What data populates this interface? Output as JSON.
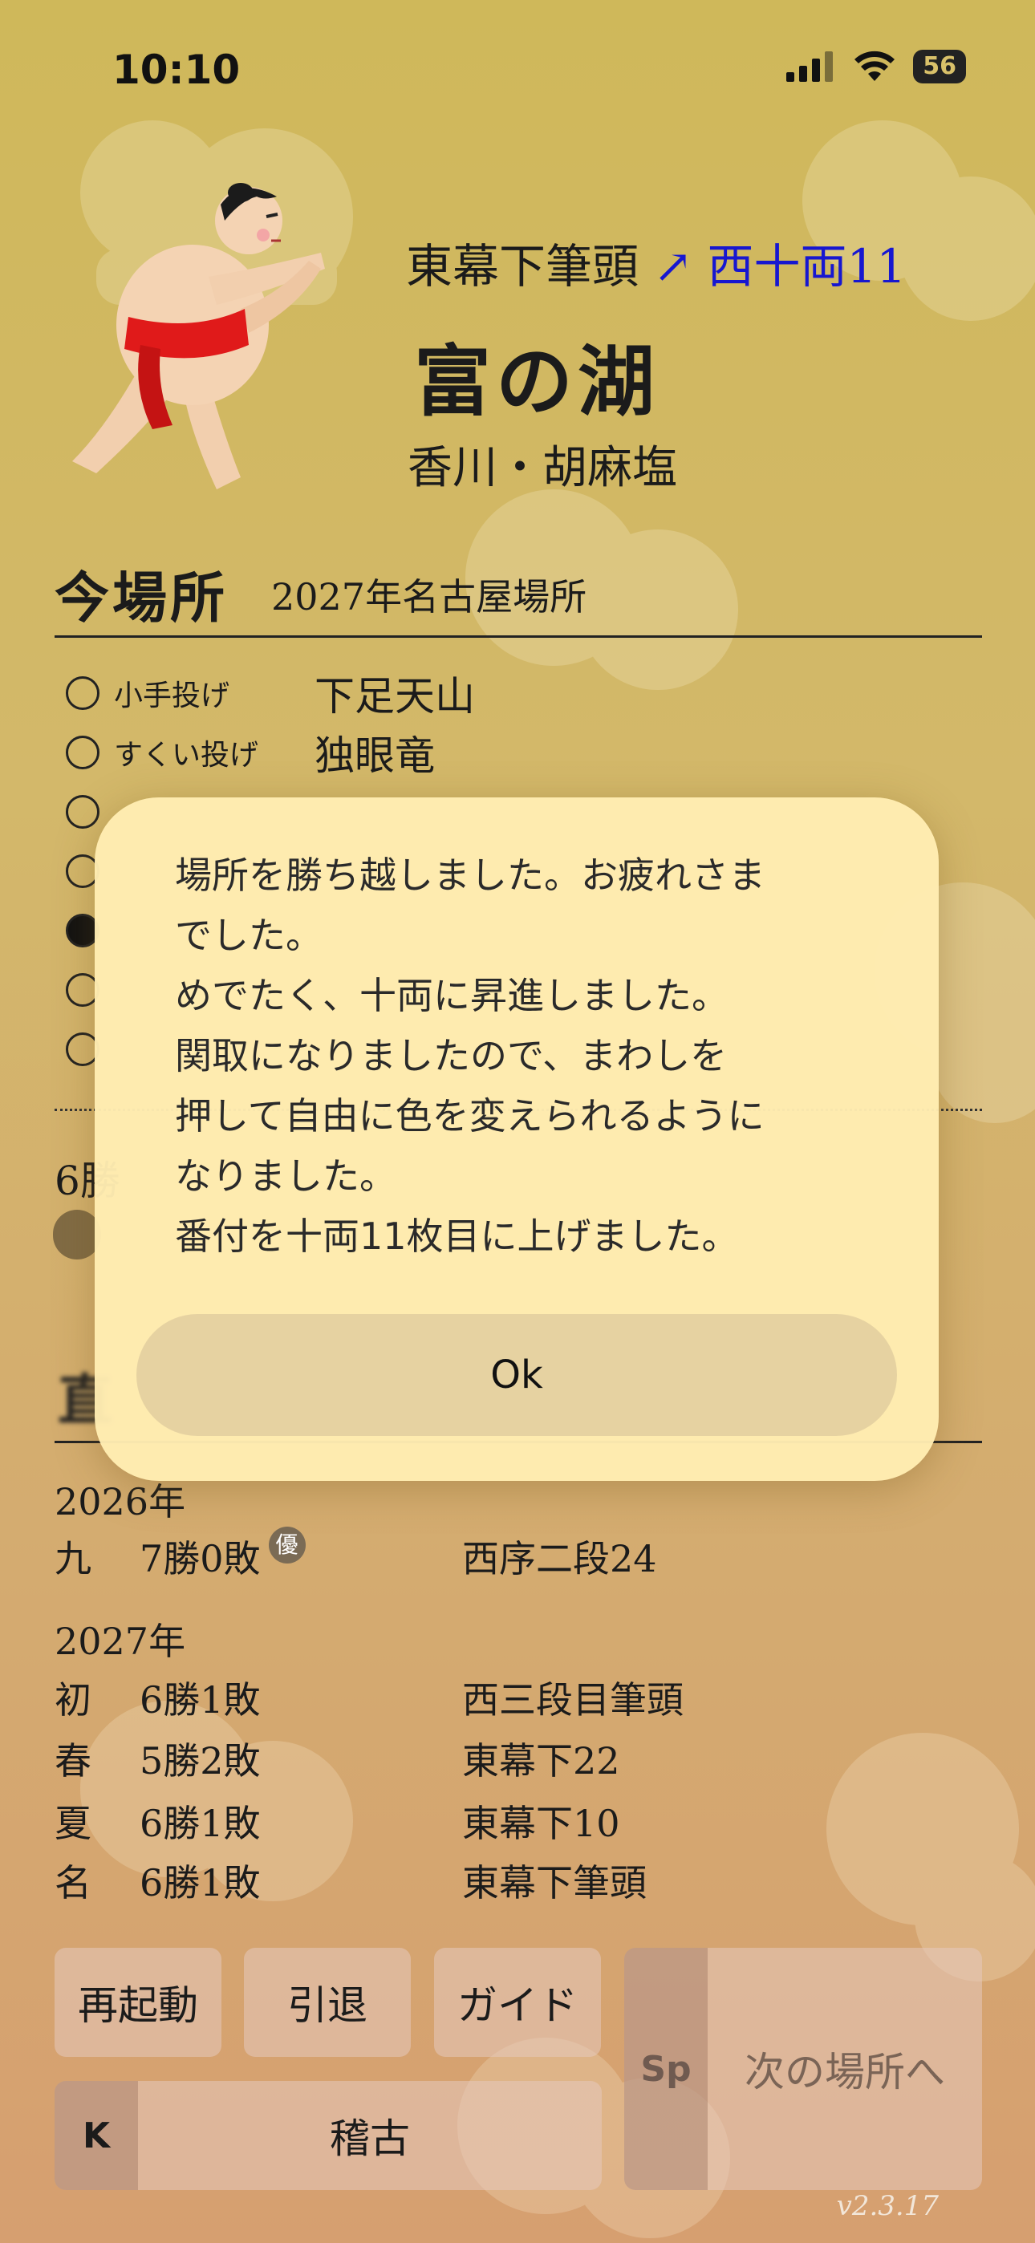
{
  "status_bar": {
    "time": "10:10",
    "battery": "56"
  },
  "wrestler": {
    "current_rank": "東幕下筆頭",
    "arrow": "↗",
    "new_rank": "西十両11",
    "shikona": "富の湖",
    "origin": "香川・胡麻塩"
  },
  "current_basho": {
    "title": "今場所",
    "name": "2027年名古屋場所",
    "bouts": [
      {
        "technique": "小手投げ",
        "opponent": "下足天山",
        "selected": false
      },
      {
        "technique": "すくい投げ",
        "opponent": "独眼竜",
        "selected": false
      },
      {
        "technique": "",
        "opponent": "",
        "selected": false
      },
      {
        "technique": "",
        "opponent": "",
        "selected": false
      },
      {
        "technique": "",
        "opponent": "",
        "selected": true
      },
      {
        "technique": "",
        "opponent": "",
        "selected": false
      },
      {
        "technique": "",
        "opponent": "",
        "selected": false
      }
    ],
    "partial_text": "6勝"
  },
  "history": {
    "years": [
      {
        "year": "2026年",
        "rows": [
          {
            "basho": "九",
            "record": "7勝0敗",
            "yusho": "優",
            "rank": "西序二段24"
          }
        ]
      },
      {
        "year": "2027年",
        "rows": [
          {
            "basho": "初",
            "record": "6勝1敗",
            "rank": "西三段目筆頭"
          },
          {
            "basho": "春",
            "record": "5勝2敗",
            "rank": "東幕下22"
          },
          {
            "basho": "夏",
            "record": "6勝1敗",
            "rank": "東幕下10"
          },
          {
            "basho": "名",
            "record": "6勝1敗",
            "rank": "東幕下筆頭"
          }
        ]
      }
    ]
  },
  "buttons": {
    "restart": "再起動",
    "retire": "引退",
    "guide": "ガイド",
    "k": "K",
    "keiko": "稽古",
    "sp": "Sp",
    "next_basho": "次の場所へ"
  },
  "version": "v2.3.17",
  "dialog": {
    "lines": [
      "場所を勝ち越しました。お疲れさま",
      "でした。",
      "めでたく、十両に昇進しました。",
      "関取になりましたので、まわしを",
      "押して自由に色を変えられるように",
      "なりました。",
      "番付を十両11枚目に上げました。"
    ],
    "ok": "Ok"
  }
}
